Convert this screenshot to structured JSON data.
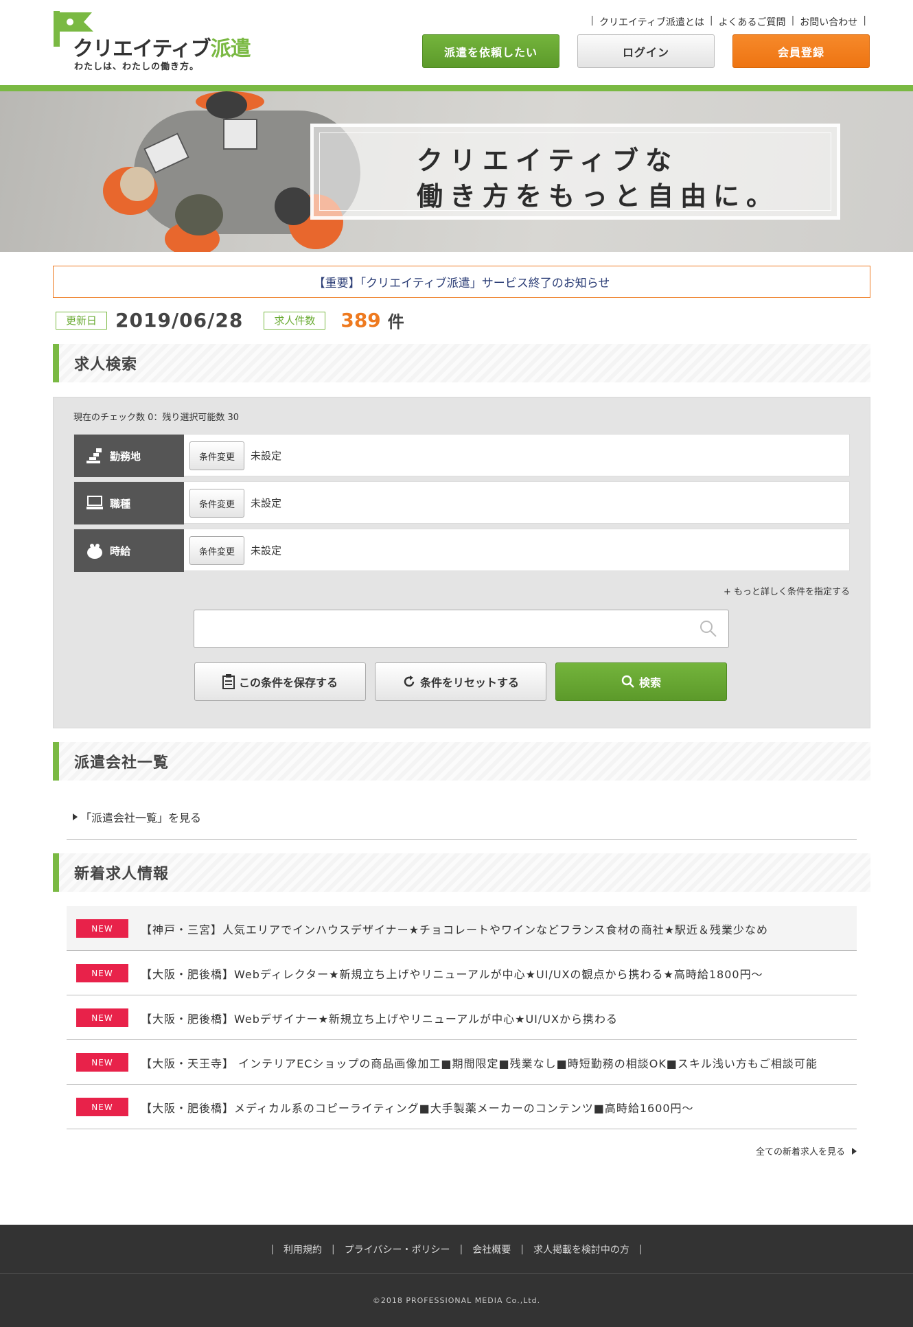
{
  "header": {
    "logo_main": "クリエイティブ",
    "logo_accent": "派遣",
    "logo_tagline": "わたしは、わたしの働き方。",
    "top_links": [
      "クリエイティブ派遣とは",
      "よくあるご質問",
      "お問い合わせ"
    ],
    "btn_request": "派遣を依頼したい",
    "btn_login": "ログイン",
    "btn_register": "会員登録"
  },
  "hero": {
    "line1": "クリエイティブな",
    "line2": "働き方をもっと自由に。"
  },
  "notice": "【重要】「クリエイティブ派遣」サービス終了のお知らせ",
  "stats": {
    "updated_label": "更新日",
    "updated_date": "2019/06/28",
    "jobs_label": "求人件数",
    "jobs_count": "389",
    "jobs_unit": "件"
  },
  "search": {
    "heading": "求人検索",
    "check_count": "現在のチェック数 0：残り選択可能数 30",
    "conditions": [
      {
        "label": "勤務地",
        "button": "条件変更",
        "value": "未設定",
        "icon": "location-icon"
      },
      {
        "label": "職種",
        "button": "条件変更",
        "value": "未設定",
        "icon": "computer-icon"
      },
      {
        "label": "時給",
        "button": "条件変更",
        "value": "未設定",
        "icon": "wallet-icon"
      }
    ],
    "more_link": "+ もっと詳しく条件を指定する",
    "input_value": "",
    "btn_save": "この条件を保存する",
    "btn_reset": "条件をリセットする",
    "btn_search": "検索"
  },
  "company": {
    "heading": "派遣会社一覧",
    "link": "「派遣会社一覧」を見る"
  },
  "new_jobs": {
    "heading": "新着求人情報",
    "badge": "NEW",
    "items": [
      "【神戸・三宮】人気エリアでインハウスデザイナー★チョコレートやワインなどフランス食材の商社★駅近＆残業少なめ",
      "【大阪・肥後橋】Webディレクター★新規立ち上げやリニューアルが中心★UI/UXの観点から携わる★高時給1800円～",
      "【大阪・肥後橋】Webデザイナー★新規立ち上げやリニューアルが中心★UI/UXから携わる",
      "【大阪・天王寺】 インテリアECショップの商品画像加工■期間限定■残業なし■時短勤務の相談OK■スキル浅い方もご相談可能",
      "【大阪・肥後橋】メディカル系のコピーライティング■大手製薬メーカーのコンテンツ■高時給1600円～"
    ],
    "all_link": "全ての新着求人を見る"
  },
  "footer": {
    "links": [
      "利用規約",
      "プライバシー・ポリシー",
      "会社概要",
      "求人掲載を検討中の方"
    ],
    "copyright": "©2018 PROFESSIONAL MEDIA Co.,Ltd."
  },
  "colors": {
    "brand_green": "#7ab943",
    "accent_orange": "#ee7a20",
    "new_red": "#e8224a",
    "footer_dark": "#333333"
  }
}
